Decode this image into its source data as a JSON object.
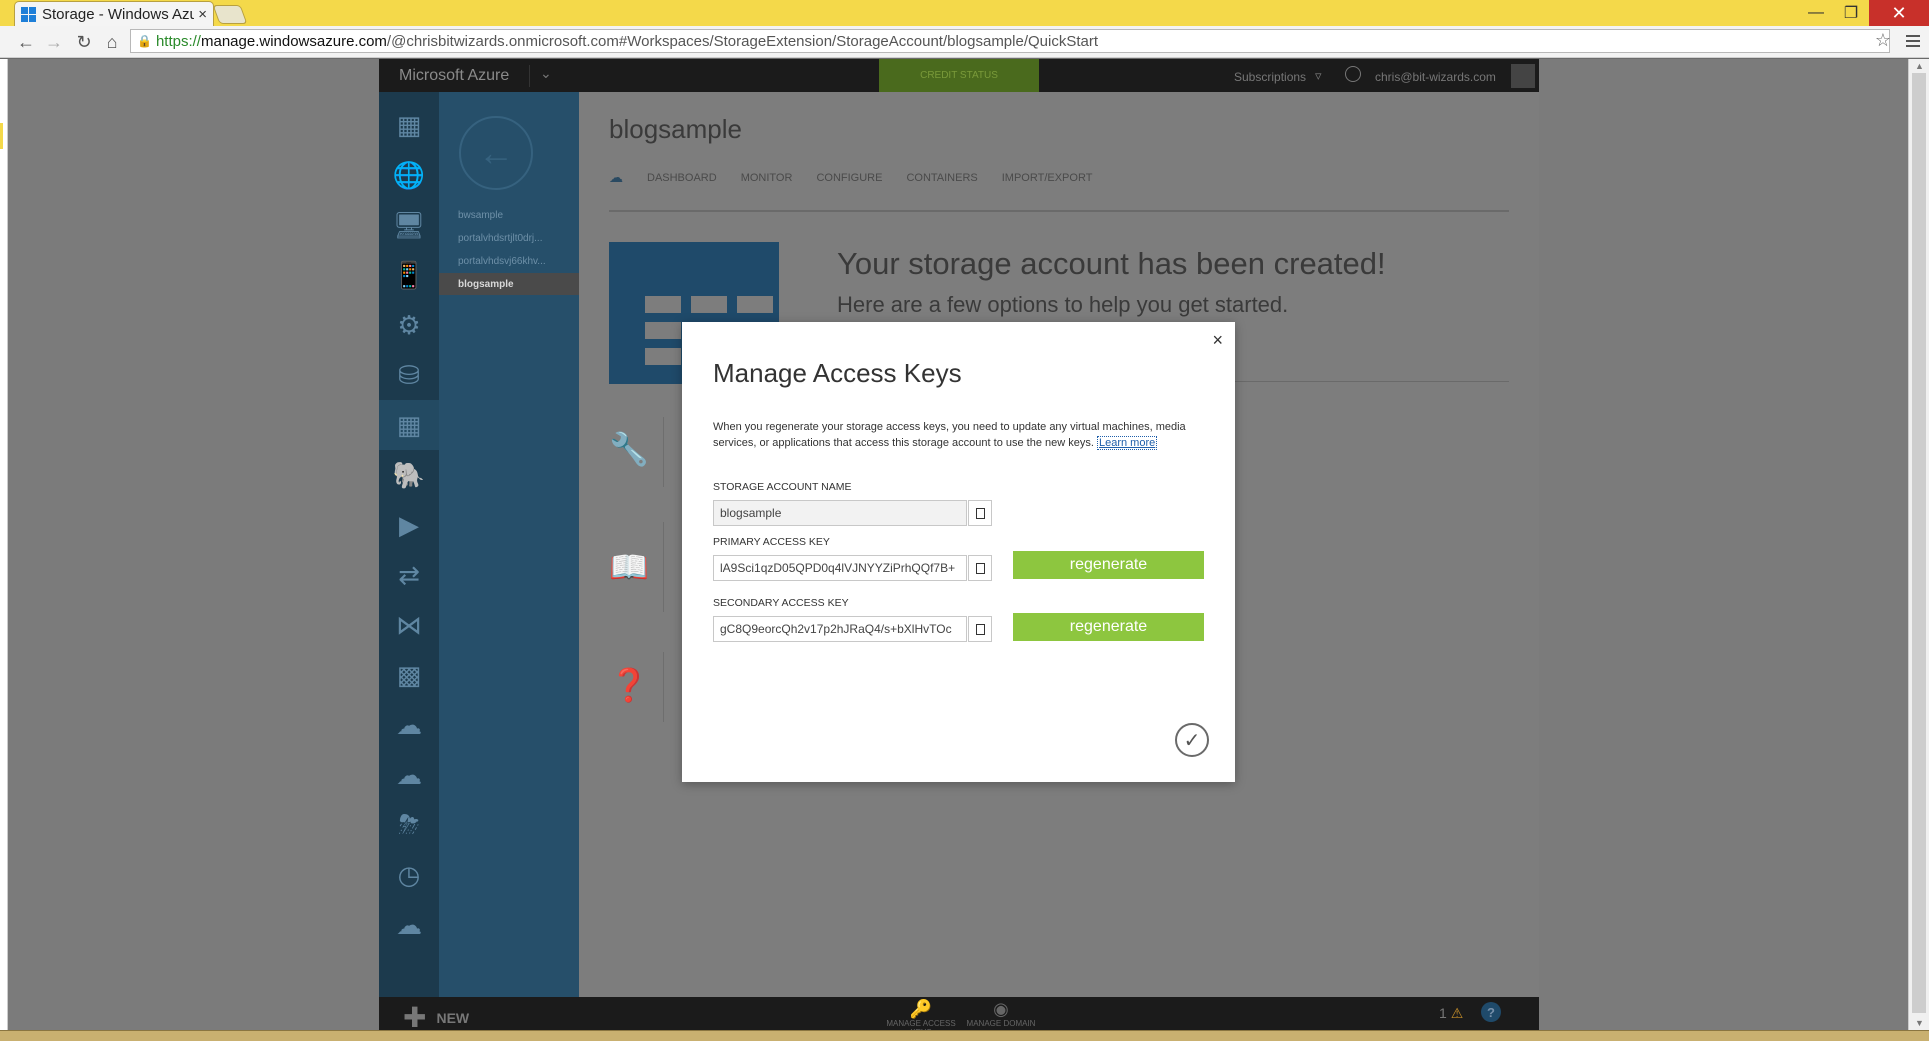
{
  "browser": {
    "tab_title": "Storage - Windows Azure",
    "tab_close": "×",
    "url_https": "https://",
    "url_host": "manage.windowsazure.com",
    "url_path": "/@chrisbitwizards.onmicrosoft.com#Workspaces/StorageExtension/StorageAccount/blogsample/QuickStart"
  },
  "portal": {
    "brand": "Microsoft Azure",
    "credit_status": "CREDIT STATUS",
    "subscriptions_label": "Subscriptions",
    "user_email": "chris@bit-wizards.com",
    "rail_icons": [
      "all-items-icon",
      "web-sites-icon",
      "virtual-machines-icon",
      "mobile-services-icon",
      "cloud-services-icon",
      "sql-databases-icon",
      "storage-icon",
      "hdinsight-icon",
      "media-services-icon",
      "service-bus-icon",
      "visual-studio-icon",
      "cache-icon",
      "biztalk-icon",
      "recovery-services-icon",
      "cdn-icon",
      "scheduler-icon",
      "api-management-icon"
    ],
    "subnav_items": [
      {
        "label": "bwsample",
        "active": false
      },
      {
        "label": "portalvhdsrtjlt0drj...",
        "active": false
      },
      {
        "label": "portalvhdsvj66khv...",
        "active": false
      },
      {
        "label": "blogsample",
        "active": true
      }
    ],
    "resource_title": "blogsample",
    "tabs": [
      "DASHBOARD",
      "MONITOR",
      "CONFIGURE",
      "CONTAINERS",
      "IMPORT/EXPORT"
    ],
    "quickstart_heading": "Your storage account has been created!",
    "quickstart_sub": "Here are a few options to help you get started.",
    "command_bar": {
      "new_label": "NEW",
      "manage_access_keys": "MANAGE ACCESS KEYS",
      "manage_domain": "MANAGE DOMAIN",
      "notification_count": "1"
    }
  },
  "modal": {
    "title": "Manage Access Keys",
    "description": "When you regenerate your storage access keys, you need to update any virtual machines, media services, or applications that access this storage account to use the new keys.",
    "learn_more": "Learn more",
    "storage_account_label": "STORAGE ACCOUNT NAME",
    "storage_account_value": "blogsample",
    "primary_label": "PRIMARY ACCESS KEY",
    "primary_value": "lA9Sci1qzD05QPD0q4lVJNYYZiPrhQQf7B+",
    "secondary_label": "SECONDARY ACCESS KEY",
    "secondary_value": "gC8Q9eorcQh2v17p2hJRaQ4/s+bXlHvTOc",
    "regenerate_label": "regenerate",
    "close_symbol": "×",
    "ok_symbol": "✓"
  },
  "colors": {
    "regenerate_green": "#8dc63f",
    "rail_blue": "#1c3a4d",
    "subnav_blue": "#264f6a",
    "title_bar_yellow": "#f4d94a"
  }
}
